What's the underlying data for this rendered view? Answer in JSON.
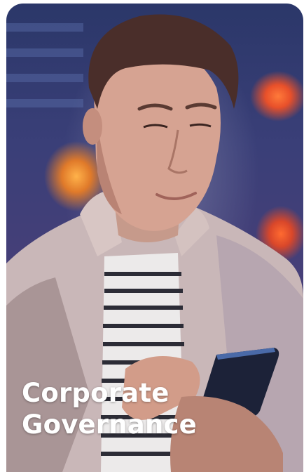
{
  "card": {
    "title_line_1": "Corporate",
    "title_line_2": "Governance"
  }
}
